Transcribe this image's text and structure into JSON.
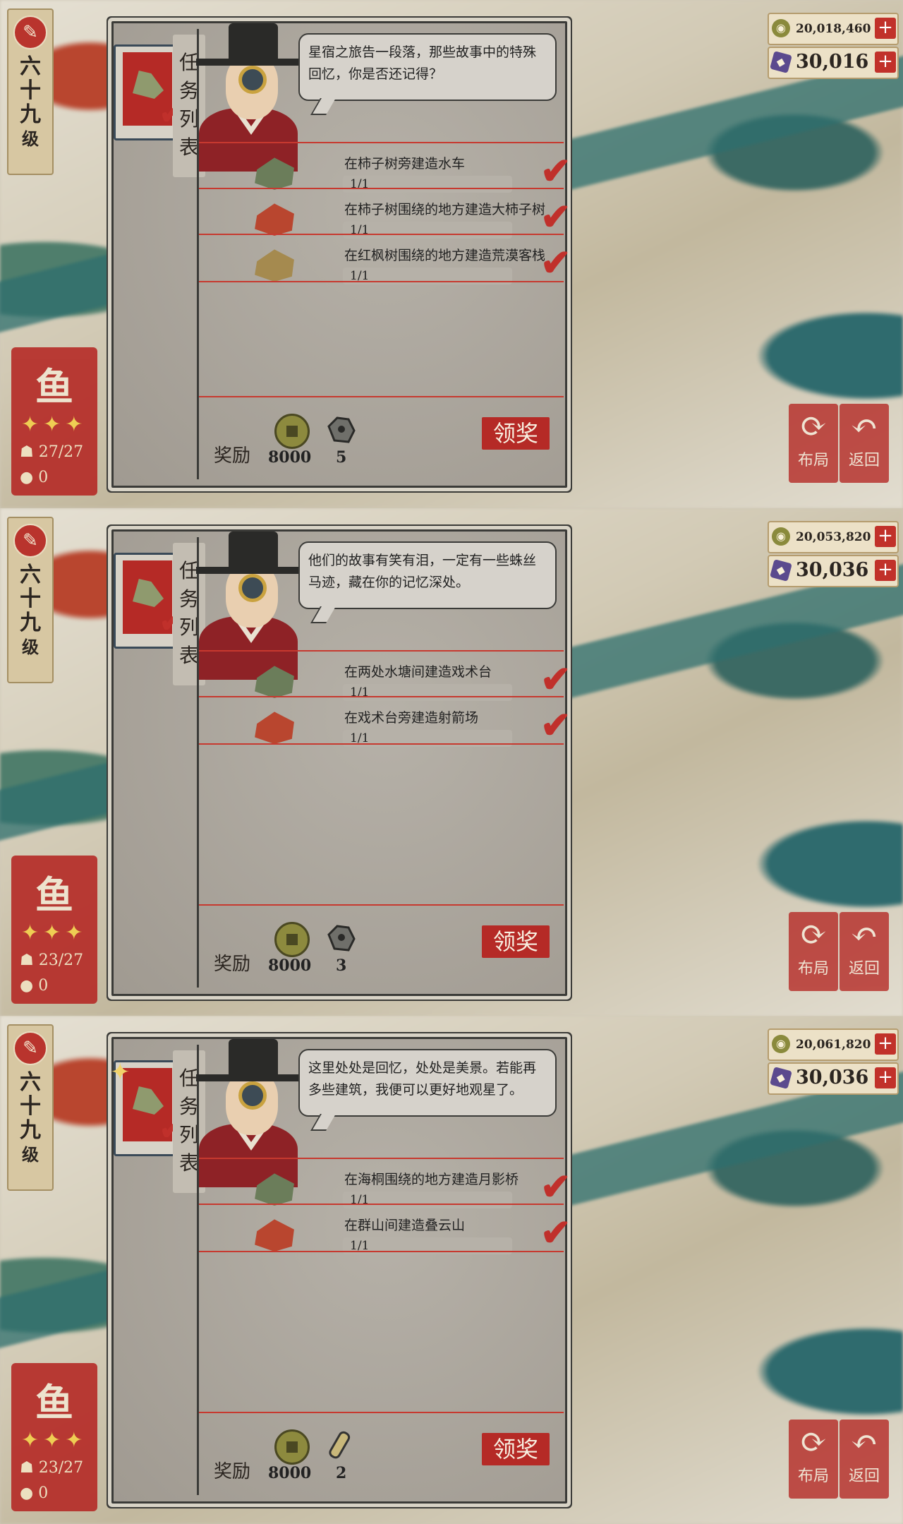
{
  "level": {
    "icon": "compass-icon",
    "line1": "六",
    "line2": "十",
    "line3": "九",
    "line4": "级"
  },
  "panels": [
    {
      "currency": {
        "coins": "20,018,460",
        "gems": "30,016"
      },
      "card": {
        "name": "鱼",
        "stars": "✦✦✦",
        "count": "27/27",
        "coin": "0"
      },
      "buttons": {
        "b1": "布局",
        "b2": "返回"
      },
      "tab": {
        "c1": "任",
        "c2": "务",
        "c3": "列",
        "c4": "表"
      },
      "speech": "星宿之旅告一段落，那些故事中的特殊回忆，你是否还记得？",
      "tasks": [
        {
          "name": "在柿子树旁建造水车",
          "progress": "1/1"
        },
        {
          "name": "在柿子树围绕的地方建造大柿子树",
          "progress": "1/1"
        },
        {
          "name": "在红枫树围绕的地方建造荒漠客栈",
          "progress": "1/1"
        }
      ],
      "reward": {
        "label": "奖励",
        "coin_value": "8000",
        "item_value": "5",
        "item_icon": "stone-icon",
        "claim": "领奖"
      }
    },
    {
      "currency": {
        "coins": "20,053,820",
        "gems": "30,036"
      },
      "card": {
        "name": "鱼",
        "stars": "✦✦✦",
        "count": "23/27",
        "coin": "0"
      },
      "buttons": {
        "b1": "布局",
        "b2": "返回"
      },
      "tab": {
        "c1": "任",
        "c2": "务",
        "c3": "列",
        "c4": "表"
      },
      "speech": "他们的故事有笑有泪，一定有一些蛛丝马迹，藏在你的记忆深处。",
      "tasks": [
        {
          "name": "在两处水塘间建造戏术台",
          "progress": "1/1"
        },
        {
          "name": "在戏术台旁建造射箭场",
          "progress": "1/1"
        }
      ],
      "reward": {
        "label": "奖励",
        "coin_value": "8000",
        "item_value": "3",
        "item_icon": "stone-icon",
        "claim": "领奖"
      }
    },
    {
      "currency": {
        "coins": "20,061,820",
        "gems": "30,036"
      },
      "card": {
        "name": "鱼",
        "stars": "✦✦✦",
        "count": "23/27",
        "coin": "0"
      },
      "buttons": {
        "b1": "布局",
        "b2": "返回"
      },
      "tab": {
        "c1": "任",
        "c2": "务",
        "c3": "列",
        "c4": "表"
      },
      "speech": "这里处处是回忆，处处是美景。若能再多些建筑，我便可以更好地观星了。",
      "tasks": [
        {
          "name": "在海桐围绕的地方建造月影桥",
          "progress": "1/1"
        },
        {
          "name": "在群山间建造叠云山",
          "progress": "1/1"
        }
      ],
      "reward": {
        "label": "奖励",
        "coin_value": "8000",
        "item_value": "2",
        "item_icon": "scroll-icon",
        "claim": "领奖"
      }
    }
  ],
  "colors": {
    "accent_red": "#b52a26",
    "paper": "#a7a29a",
    "check": "#c0302b"
  }
}
